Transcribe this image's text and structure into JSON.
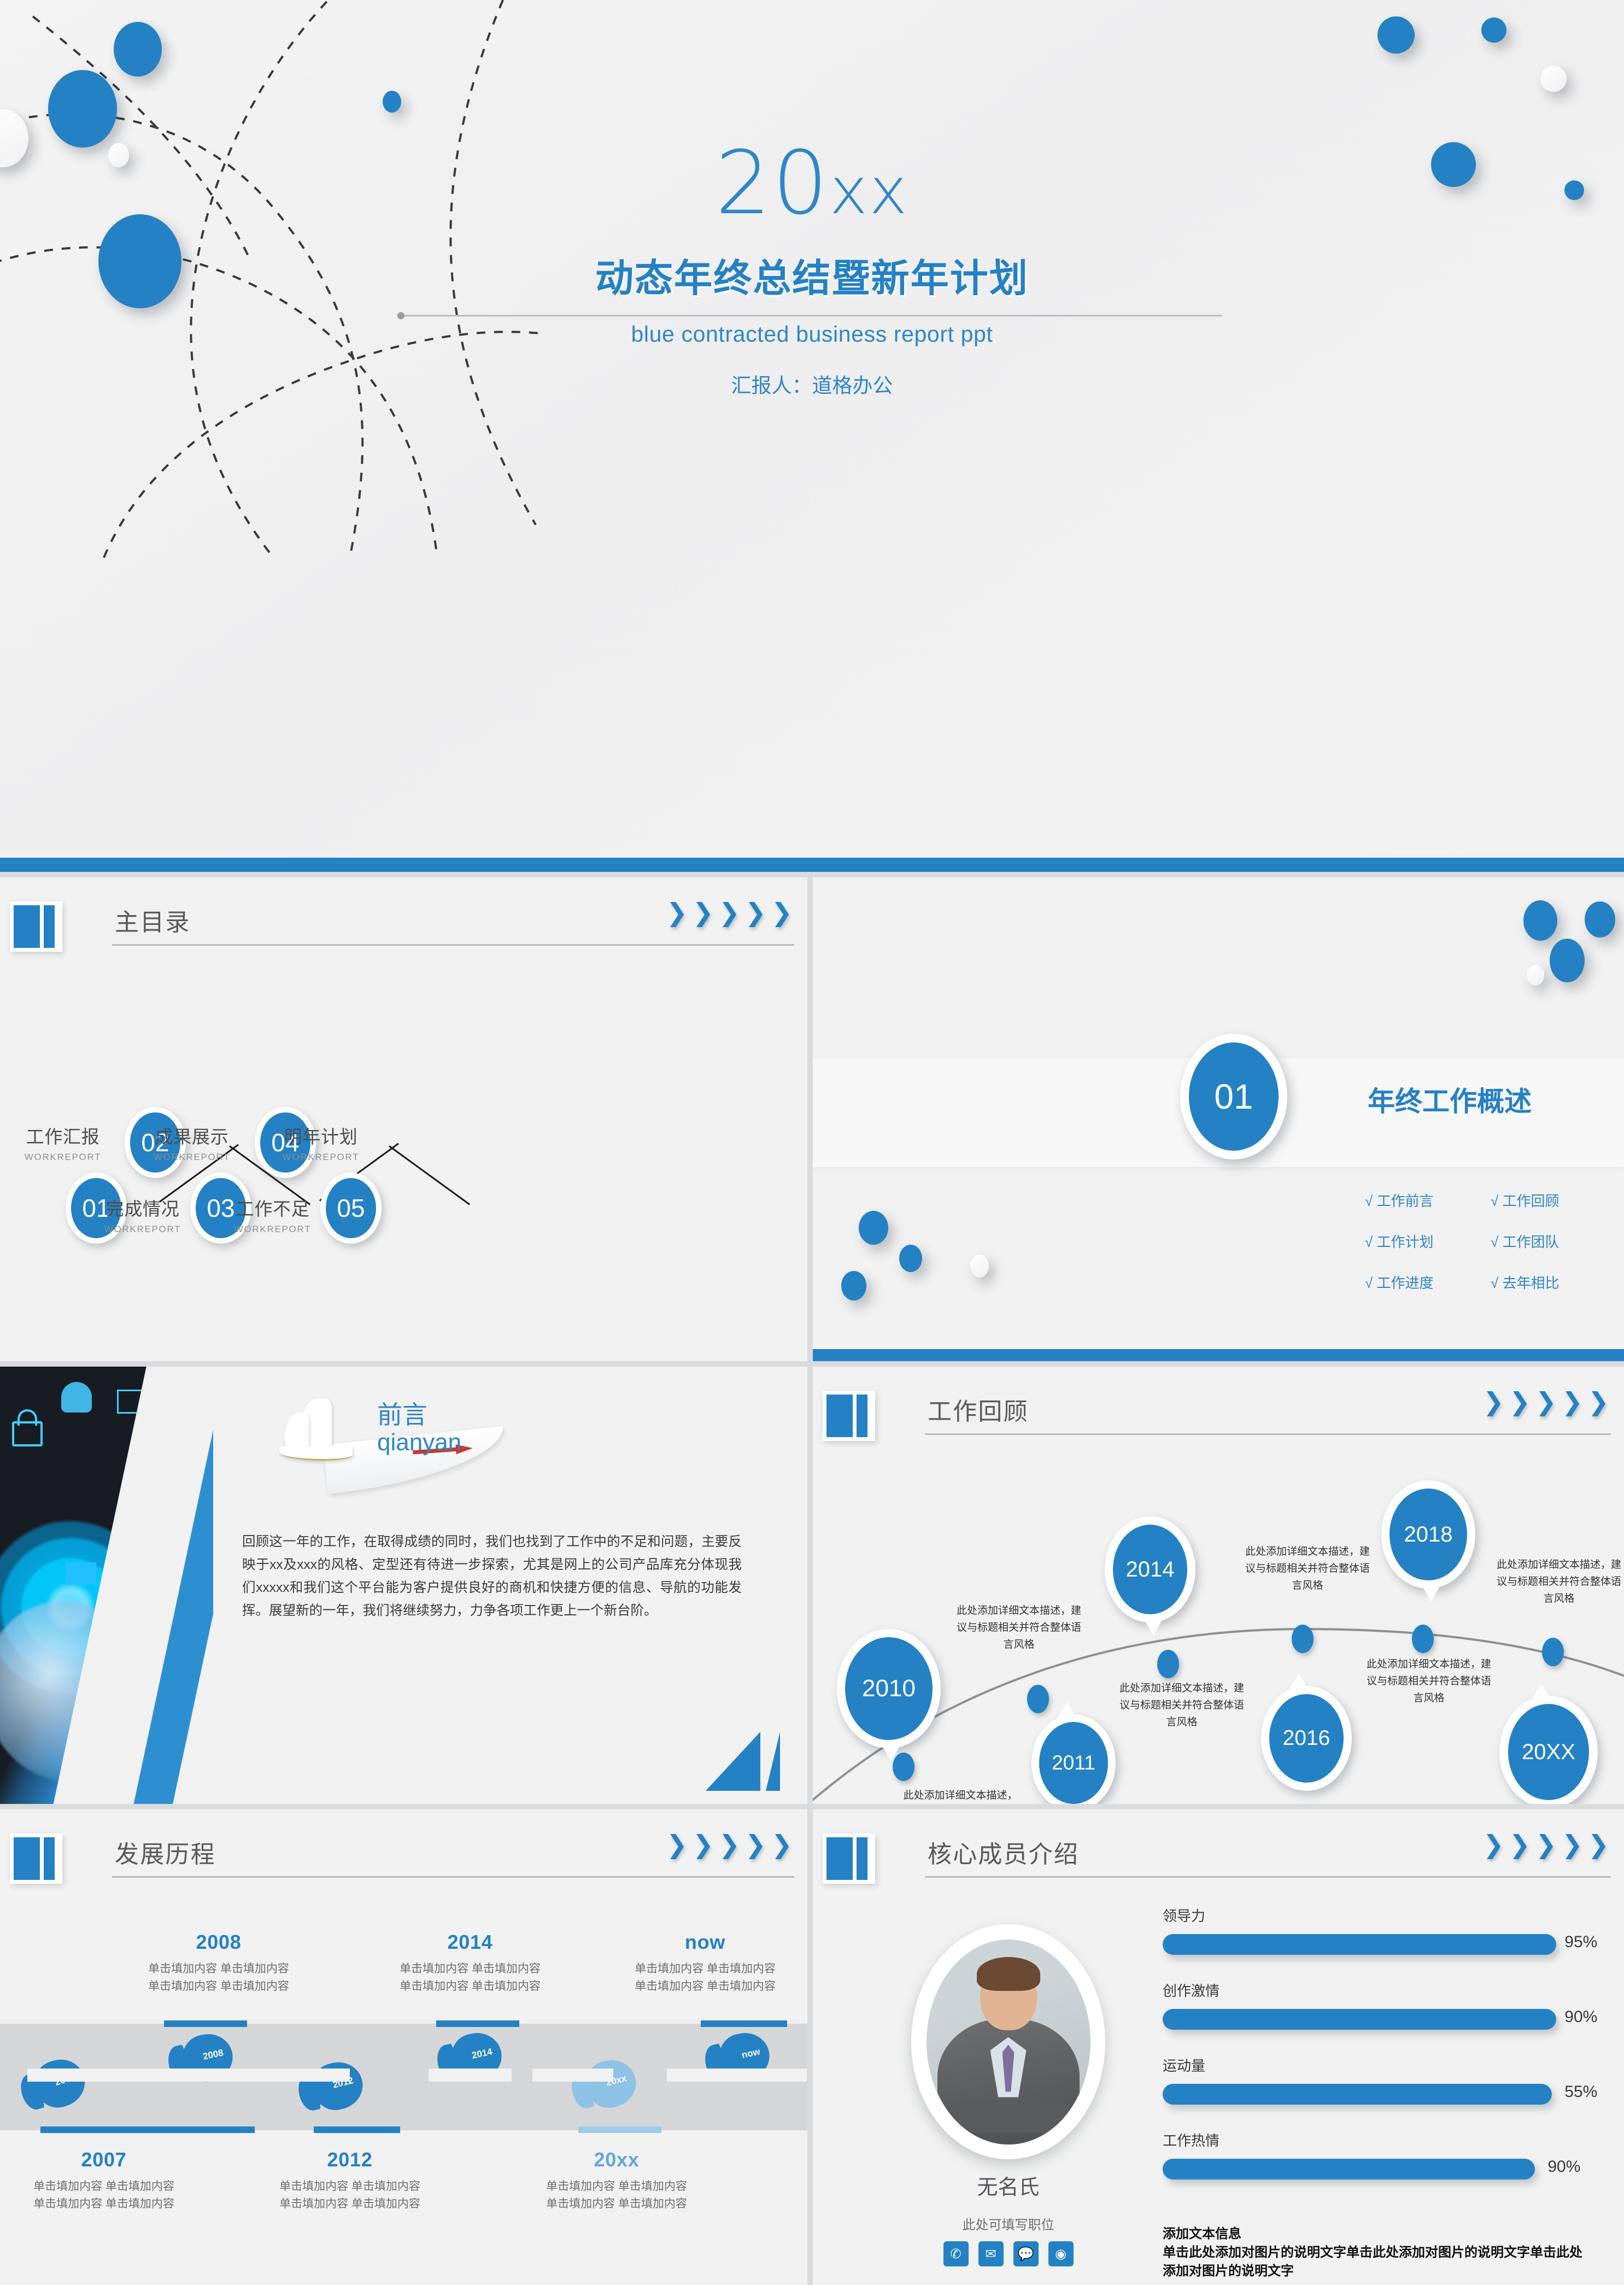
{
  "cover": {
    "year_num": "20",
    "year_xx": "xx",
    "title": "动态年终总结暨新年计划",
    "subtitle": "blue contracted business report ppt",
    "reporter": "汇报人：道格办公"
  },
  "toc_slide": {
    "header_title": "主目录",
    "chevrons": [
      "❯",
      "❯",
      "❯",
      "❯",
      "❯"
    ],
    "items": [
      {
        "num": "01",
        "label": "工作汇报",
        "sub": "WORKREPORT"
      },
      {
        "num": "02",
        "label": "完成情况",
        "sub": "WORKREPORT"
      },
      {
        "num": "03",
        "label": "成果展示",
        "sub": "WORKREPORT"
      },
      {
        "num": "04",
        "label": "工作不足",
        "sub": "WORKREPORT"
      },
      {
        "num": "05",
        "label": "明年计划",
        "sub": "WORKREPORT"
      }
    ]
  },
  "divider_slide": {
    "number": "01",
    "title": "年终工作概述",
    "bullets": [
      "√ 工作前言",
      "√ 工作回顾",
      "√ 工作计划",
      "√ 工作团队",
      "√ 工作进度",
      "√ 去年相比"
    ]
  },
  "preface_slide": {
    "title_cn": "前言",
    "title_en": "qianyan",
    "body": "回顾这一年的工作，在取得成绩的同时，我们也找到了工作中的不足和问题，主要反映于xx及xxx的风格、定型还有待进一步探索，尤其是网上的公司产品库充分体现我们xxxxx和我们这个平台能为客户提供良好的商机和快捷方便的信息、导航的功能发挥。展望新的一年，我们将继续努力，力争各项工作更上一个新台阶。"
  },
  "review_slide": {
    "header_title": "工作回顾",
    "chevrons": [
      "❯",
      "❯",
      "❯",
      "❯",
      "❯"
    ],
    "nodes": [
      {
        "year": "2010",
        "text": "此处添加详细文本描述，建议与标题相关并符合整体语言风格"
      },
      {
        "year": "2011",
        "text": "此处添加详细文本描述，建议与标题相关并符合整体语言风格"
      },
      {
        "year": "2014",
        "text": "此处添加详细文本描述，建议与标题相关并符合整体语言风格"
      },
      {
        "year": "2016",
        "text": "此处添加详细文本描述，建议与标题相关并符合整体语言风格"
      },
      {
        "year": "2018",
        "text": "此处添加详细文本描述，建议与标题相关并符合整体语言风格"
      },
      {
        "year": "20XX",
        "text": "此处添加详细文本描述，建议与标题相关并符合整体语言风格"
      }
    ]
  },
  "history_slide": {
    "header_title": "发展历程",
    "chevrons": [
      "❯",
      "❯",
      "❯",
      "❯",
      "❯"
    ],
    "top_items": [
      {
        "year": "2008",
        "desc": "单击填加内容 单击填加内容\n单击填加内容 单击填加内容"
      },
      {
        "year": "2014",
        "desc": "单击填加内容 单击填加内容\n单击填加内容 单击填加内容"
      },
      {
        "year": "now",
        "desc": "单击填加内容 单击填加内容\n单击填加内容 单击填加内容"
      }
    ],
    "bottom_items": [
      {
        "year": "2007",
        "desc": "单击填加内容 单击填加内容\n单击填加内容 单击填加内容"
      },
      {
        "year": "2012",
        "desc": "单击填加内容 单击填加内容\n单击填加内容 单击填加内容"
      },
      {
        "year": "20xx",
        "desc": "单击填加内容 单击填加内容\n单击填加内容 单击填加内容"
      }
    ],
    "footprints": [
      "2007",
      "2008",
      "2012",
      "2014",
      "20xx",
      "now"
    ]
  },
  "member_slide": {
    "header_title": "核心成员介绍",
    "chevrons": [
      "❯",
      "❯",
      "❯",
      "❯",
      "❯"
    ],
    "name": "无名氏",
    "role": "此处可填写职位",
    "socials": [
      "phone-icon",
      "mail-icon",
      "chat-icon",
      "weibo-icon"
    ],
    "social_glyphs": [
      "✆",
      "✉",
      "💬",
      "◉"
    ],
    "skills": [
      {
        "label": "领导力",
        "pct": "95%",
        "value": 95
      },
      {
        "label": "创作激情",
        "pct": "90%",
        "value": 90
      },
      {
        "label": "运动量",
        "pct": "55%",
        "value": 55
      },
      {
        "label": "工作热情",
        "pct": "90%",
        "value": 90
      }
    ],
    "note_title": "添加文本信息",
    "note_body": "单击此处添加对图片的说明文字单击此处添加对图片的说明文字单击此处添加对图片的说明文字"
  },
  "theme": {
    "accent": "#2481c4",
    "accent_light": "#2f86c8",
    "bg": "#f1f1f1",
    "band": "#d5d6d8"
  }
}
